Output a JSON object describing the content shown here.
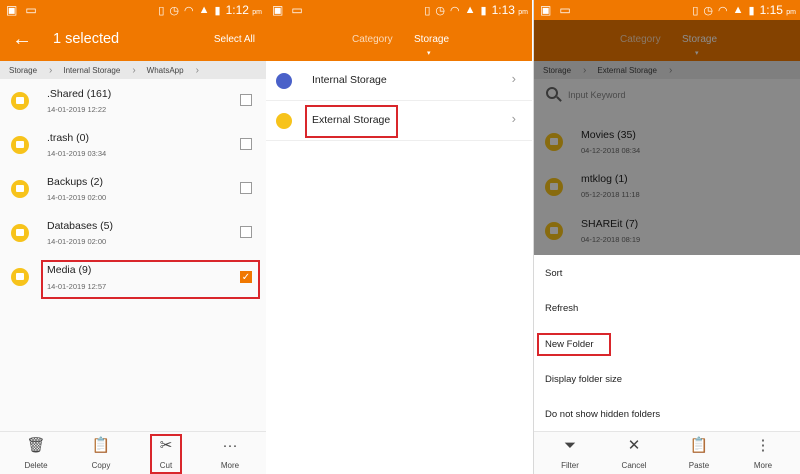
{
  "status": {
    "p1_time": "1:12",
    "p2_time": "1:13",
    "p3_time": "1:15",
    "ampm": "pm",
    "left_icons": [
      "image-icon",
      "laptop-icon"
    ],
    "right_icons": [
      "vibrate-icon",
      "alarm-icon",
      "wifi-icon",
      "signal-icon",
      "battery-icon"
    ]
  },
  "panel1": {
    "title": "1 selected",
    "select_all": "Select All",
    "breadcrumb": [
      "Storage",
      "Internal Storage",
      "WhatsApp"
    ],
    "files": [
      {
        "name": ".Shared (161)",
        "date": "14-01-2019 12:22",
        "checked": false
      },
      {
        "name": ".trash (0)",
        "date": "14-01-2019 03:34",
        "checked": false
      },
      {
        "name": "Backups (2)",
        "date": "14-01-2019 02:00",
        "checked": false
      },
      {
        "name": "Databases (5)",
        "date": "14-01-2019 02:00",
        "checked": false
      },
      {
        "name": "Media (9)",
        "date": "14-01-2019 12:57",
        "checked": true
      }
    ],
    "toolbar": [
      {
        "label": "Delete",
        "icon": "trash-icon"
      },
      {
        "label": "Copy",
        "icon": "clipboard-icon"
      },
      {
        "label": "Cut",
        "icon": "scissors-icon"
      },
      {
        "label": "More",
        "icon": "more-dots-icon"
      }
    ]
  },
  "panel2": {
    "tabs": [
      "Category",
      "Storage"
    ],
    "active_tab": "Storage",
    "storage": [
      {
        "name": "Internal Storage",
        "icon": "phone-icon",
        "color": "#4a61c9"
      },
      {
        "name": "External Storage",
        "icon": "sdcard-icon",
        "color": "#f7c31b"
      }
    ]
  },
  "panel3": {
    "tabs": [
      "Category",
      "Storage"
    ],
    "breadcrumb": [
      "Storage",
      "External Storage"
    ],
    "search_placeholder": "Input Keyword",
    "files": [
      {
        "name": "Movies (35)",
        "date": "04-12-2018 08:34"
      },
      {
        "name": "mtklog (1)",
        "date": "05-12-2018 11:18"
      },
      {
        "name": "SHAREit (7)",
        "date": "04-12-2018 08:19"
      }
    ],
    "menu": [
      "Sort",
      "Refresh",
      "New Folder",
      "Display folder size",
      "Do not show hidden folders"
    ],
    "toolbar": [
      {
        "label": "Filter",
        "icon": "filter-icon"
      },
      {
        "label": "Cancel",
        "icon": "close-icon"
      },
      {
        "label": "Paste",
        "icon": "clipboard-icon"
      },
      {
        "label": "More",
        "icon": "more-vertical-icon"
      }
    ]
  },
  "colors": {
    "accent": "#f07800",
    "highlight_box": "#d9262b",
    "folder": "#f7c31b"
  }
}
